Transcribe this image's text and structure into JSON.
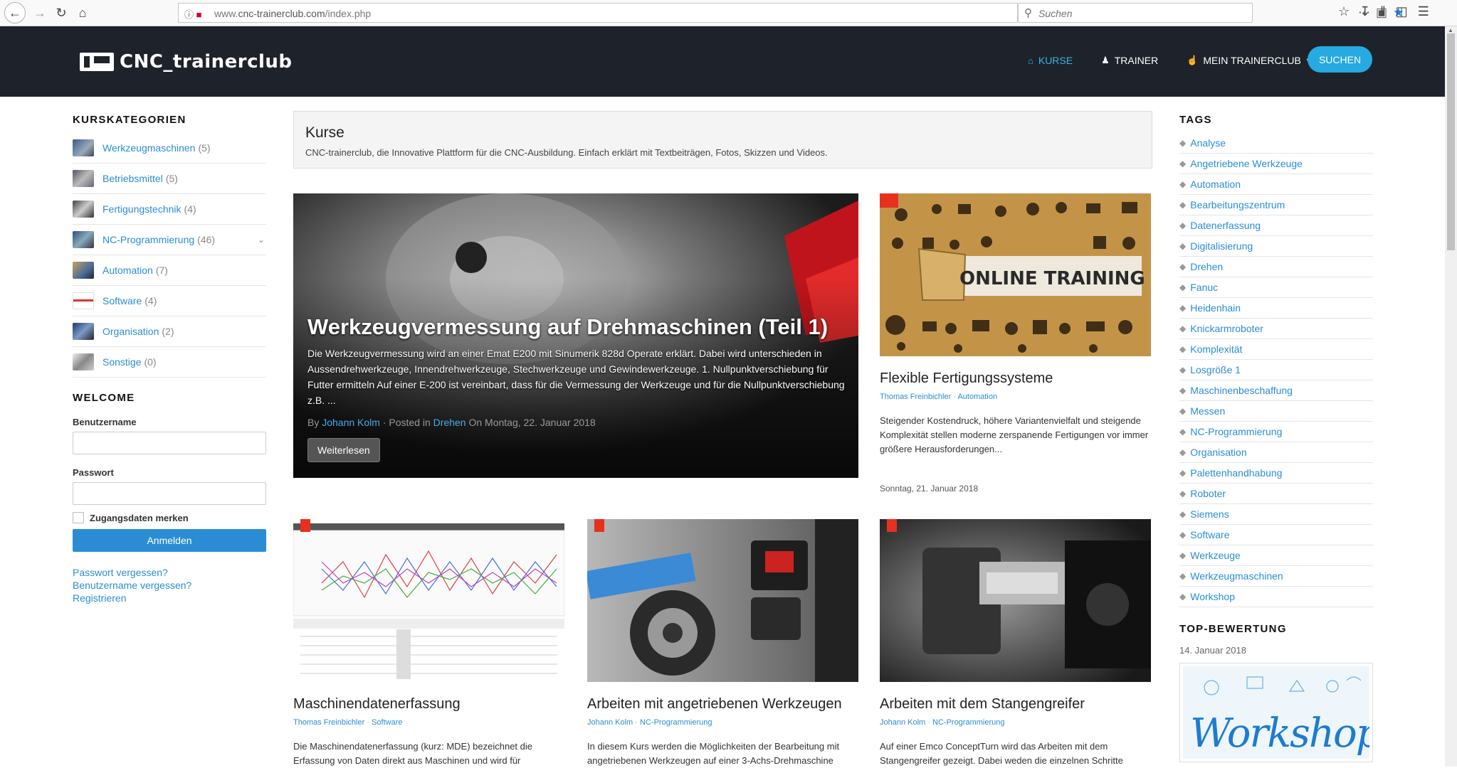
{
  "browser": {
    "url_prefix": "www.",
    "url_host": "cnc-trainerclub.com",
    "url_path": "/index.php",
    "search_placeholder": "Suchen"
  },
  "header": {
    "logo_text": "CNC_trainerclub",
    "nav": [
      {
        "label": "KURSE",
        "icon": "home-icon"
      },
      {
        "label": "TRAINER",
        "icon": "user-icon"
      },
      {
        "label": "MEIN TRAINERCLUB",
        "icon": "thumbs-up-icon"
      }
    ],
    "search_button": "SUCHEN"
  },
  "left": {
    "categories_title": "KURSKATEGORIEN",
    "categories": [
      {
        "name": "Werkzeugmaschinen",
        "count": "(5)"
      },
      {
        "name": "Betriebsmittel",
        "count": "(5)"
      },
      {
        "name": "Fertigungstechnik",
        "count": "(4)"
      },
      {
        "name": "NC-Programmierung",
        "count": "(46)"
      },
      {
        "name": "Automation",
        "count": "(7)"
      },
      {
        "name": "Software",
        "count": "(4)"
      },
      {
        "name": "Organisation",
        "count": "(2)"
      },
      {
        "name": "Sonstige",
        "count": "(0)"
      }
    ],
    "welcome_title": "WELCOME",
    "username_label": "Benutzername",
    "password_label": "Passwort",
    "remember_label": "Zugangsdaten merken",
    "login_button": "Anmelden",
    "links": [
      "Passwort vergessen?",
      "Benutzername vergessen?",
      "Registrieren"
    ]
  },
  "intro": {
    "title": "Kurse",
    "text": "CNC-trainerclub, die Innovative Plattform für die CNC-Ausbildung. Einfach erklärt mit Textbeiträgen, Fotos, Skizzen und Videos."
  },
  "feature": {
    "title": "Werkzeugvermessung auf Drehmaschinen (Teil 1)",
    "excerpt": "Die Werkzeugvermessung wird an einer Emat E200 mit Sinumerik 828d Operate erklärt. Dabei wird unterschieden in Aussendrehwerkzeuge, Innendrehwerkzeuge, Stechwerkzeuge und Gewindewerkzeuge. 1. Nullpunktverschiebung für Futter ermitteln Auf einer E-200 ist vereinbart, dass für die Vermessung der Werkzeuge und für die Nullpunktverschiebung z.B. ...",
    "by": "By",
    "author": "Johann Kolm",
    "posted_in": "· Posted in",
    "category": "Drehen",
    "on_date": "On Montag, 22. Januar 2018",
    "more_button": "Weiterlesen"
  },
  "cards": [
    {
      "title": "Flexible Fertigungssysteme",
      "author": "Thomas Freinbichler",
      "category": "Automation",
      "text": "Steigender Kostendruck, höhere Variantenvielfalt und steigende Komplexität stellen moderne zerspanende Fertigungen vor immer größere Herausforderungen...",
      "date": "Sonntag, 21. Januar 2018",
      "image_text": "ONLINE TRAINING"
    },
    {
      "title": "Maschinendatenerfassung",
      "author": "Thomas Freinbichler",
      "category": "Software",
      "text": "Die Maschinendatenerfassung (kurz: MDE) bezeichnet die Erfassung von Daten direkt aus Maschinen und wird für"
    },
    {
      "title": "Arbeiten mit angetriebenen Werkzeugen",
      "author": "Johann Kolm",
      "category": "NC-Programmierung",
      "text": "In diesem Kurs werden die Möglichkeiten der Bearbeitung mit angetriebenen Werkzeugen auf einer 3-Achs-Drehmaschine"
    },
    {
      "title": "Arbeiten mit dem Stangengreifer",
      "author": "Johann Kolm",
      "category": "NC-Programmierung",
      "text": " Auf einer Emco ConceptTurn wird das Arbeiten mit dem Stangengreifer gezeigt. Dabei weden die einzelnen Schritte"
    }
  ],
  "right": {
    "tags_title": "TAGS",
    "tags": [
      "Analyse",
      "Angetriebene Werkzeuge",
      "Automation",
      "Bearbeitungszentrum",
      "Datenerfassung",
      "Digitalisierung",
      "Drehen",
      "Fanuc",
      "Heidenhain",
      "Knickarmroboter",
      "Komplexität",
      "Losgröße 1",
      "Maschinenbeschaffung",
      "Messen",
      "NC-Programmierung",
      "Organisation",
      "Palettenhandhabung",
      "Roboter",
      "Siemens",
      "Software",
      "Werkzeuge",
      "Werkzeugmaschinen",
      "Workshop"
    ],
    "top_title": "TOP-BEWERTUNG",
    "top_date": "14. Januar 2018",
    "top_image_word": "Workshop"
  }
}
